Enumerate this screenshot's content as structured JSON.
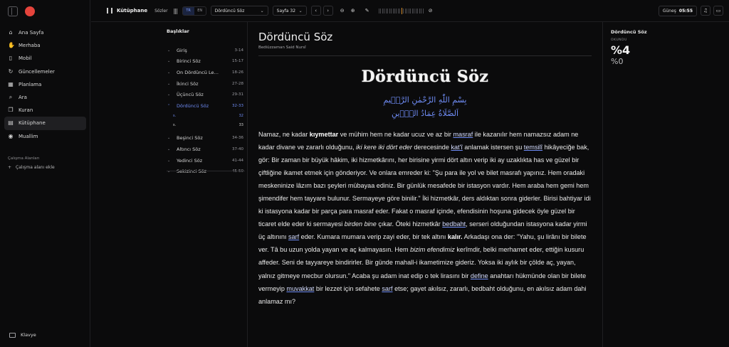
{
  "sidebar": {
    "items": [
      {
        "label": "Ana Sayfa",
        "icon": "home-icon",
        "glyph": "⌂"
      },
      {
        "label": "Merhaba",
        "icon": "wave-icon",
        "glyph": "✋"
      },
      {
        "label": "Mobil",
        "icon": "mobile-icon",
        "glyph": "▯"
      },
      {
        "label": "Güncellemeler",
        "icon": "refresh-icon",
        "glyph": "↻"
      },
      {
        "label": "Planlama",
        "icon": "calendar-icon",
        "glyph": "▦"
      },
      {
        "label": "Ara",
        "icon": "search-icon",
        "glyph": "⌕"
      },
      {
        "label": "Kuran",
        "icon": "book-icon",
        "glyph": "❐"
      },
      {
        "label": "Kütüphane",
        "icon": "library-icon",
        "glyph": "▤"
      },
      {
        "label": "Muallim",
        "icon": "user-icon",
        "glyph": "◉"
      }
    ],
    "workspace_title": "Çalışma Alanları",
    "workspace_add": "Çalışma alanı ekle",
    "keyboard": "Klavye"
  },
  "toolbar": {
    "library": "Kütüphane",
    "sozler": "Sözler",
    "lang_tr": "TR",
    "lang_en": "EN",
    "book_select": "Dördüncü Söz",
    "page_select": "Sayfa 32",
    "gunes_label": "Güneş",
    "gunes_time": "05:55"
  },
  "headings": {
    "title": "Başlıklar",
    "items": [
      {
        "label": "Giriş",
        "pages": "3-14",
        "open": false
      },
      {
        "label": "Birinci Söz",
        "pages": "15-17",
        "open": false
      },
      {
        "label": "On Dördüncü Lem'a",
        "pages": "18-26",
        "open": false
      },
      {
        "label": "İkinci Söz",
        "pages": "27-28",
        "open": false
      },
      {
        "label": "Üçüncü Söz",
        "pages": "29-31",
        "open": false
      },
      {
        "label": "Dördüncü Söz",
        "pages": "32-33",
        "open": true
      }
    ],
    "subs": [
      {
        "label": "s.",
        "page": "32",
        "current": true
      },
      {
        "label": "s.",
        "page": "33",
        "current": false
      }
    ],
    "items_after": [
      {
        "label": "Beşinci Söz",
        "pages": "34-36"
      },
      {
        "label": "Altıncı Söz",
        "pages": "37-40"
      },
      {
        "label": "Yedinci Söz",
        "pages": "41-44"
      },
      {
        "label": "Sekizinci Söz",
        "pages": "45-50"
      }
    ]
  },
  "reader": {
    "title": "Dördüncü Söz",
    "author": "Bediüzzaman Said Nursî",
    "heading": "Dördüncü Söz",
    "basmala": "بِسْمِ اللّٰهِ الرَّحْمٰنِ الرَّح۪يمِ",
    "arabic2": "اَلصَّلَاةُ عِمَادُ الدّ۪ينِ",
    "p1": "Namaz, ne kadar ",
    "p1b": "kıymettar",
    "p2": " ve mühim hem ne kadar ucuz ve az bir ",
    "u1": "masraf",
    "p3": " ile kazanılır hem namazsız adam ne kadar divane ve zararlı olduğunu, ",
    "e1": "iki kere iki dört eder",
    "p4": " derecesinde ",
    "u2": "kat'î",
    "p5": " anlamak istersen şu ",
    "u3": "temsilî",
    "p6": " hikâyeciğe bak, gör: Bir zaman bir büyük hâkim, iki hizmetkârını, her birisine yirmi dört altın verip iki ay uzaklıkta has ve güzel bir çiftliğine ikamet etmek için gönderiyor. Ve onlara emreder ki: \"Şu para ile yol ve bilet masrafı yapınız. Hem oradaki meskeninize lâzım bazı şeyleri mübayaa ediniz. Bir günlük mesafede bir istasyon vardır. Hem araba hem gemi hem şimendifer hem tayyare bulunur. Sermayeye göre binilir.\" İki hizmetkâr, ders aldıktan sonra giderler. Birisi bahtiyar idi ki istasyona kadar bir parça para masraf eder. Fakat o masraf içinde, efendisinin hoşuna gidecek öyle güzel bir ticaret elde eder ki sermayesi ",
    "e2": "birden bine",
    "p7": " çıkar. Öteki hizmetkâr ",
    "u4": "bedbaht",
    "p8": ", serseri olduğundan istasyona kadar yirmi üç altınını ",
    "u5": "sarf",
    "p9": " eder. Kumara mumara verip zayi eder, bir tek altını ",
    "p9b": "kalır.",
    "p10": " Arkadaşı ona der: \"Yahu, şu lirânı bir bilete ver. Tâ bu uzun yolda yayan ve aç kalmayasın. Hem ",
    "e3": "bizim efendimiz",
    "p11": " kerîmdir, belki merhamet eder, ettiğin kusuru affeder. Seni de tayyareye bindirirler. Bir günde mahall-i ikametimize gideriz. Yoksa iki aylık bir çölde aç, yayan, yalnız gitmeye mecbur olursun.\" Acaba şu adam inat edip o tek lirasını bir ",
    "u6": "define",
    "p12": " anahtarı hükmünde olan bir bilete vermeyip ",
    "u7": "muvakkat",
    "p13": " bir lezzet için sefahete ",
    "u8": "sarf",
    "p14": " etse; gayet akılsız, zararlı, bedbaht olduğunu, en akılsız adam dahi anlamaz mı?"
  },
  "progress": {
    "title": "Dördüncü Söz",
    "label": "OKUNDU",
    "value": "%4",
    "sub": "%0"
  }
}
